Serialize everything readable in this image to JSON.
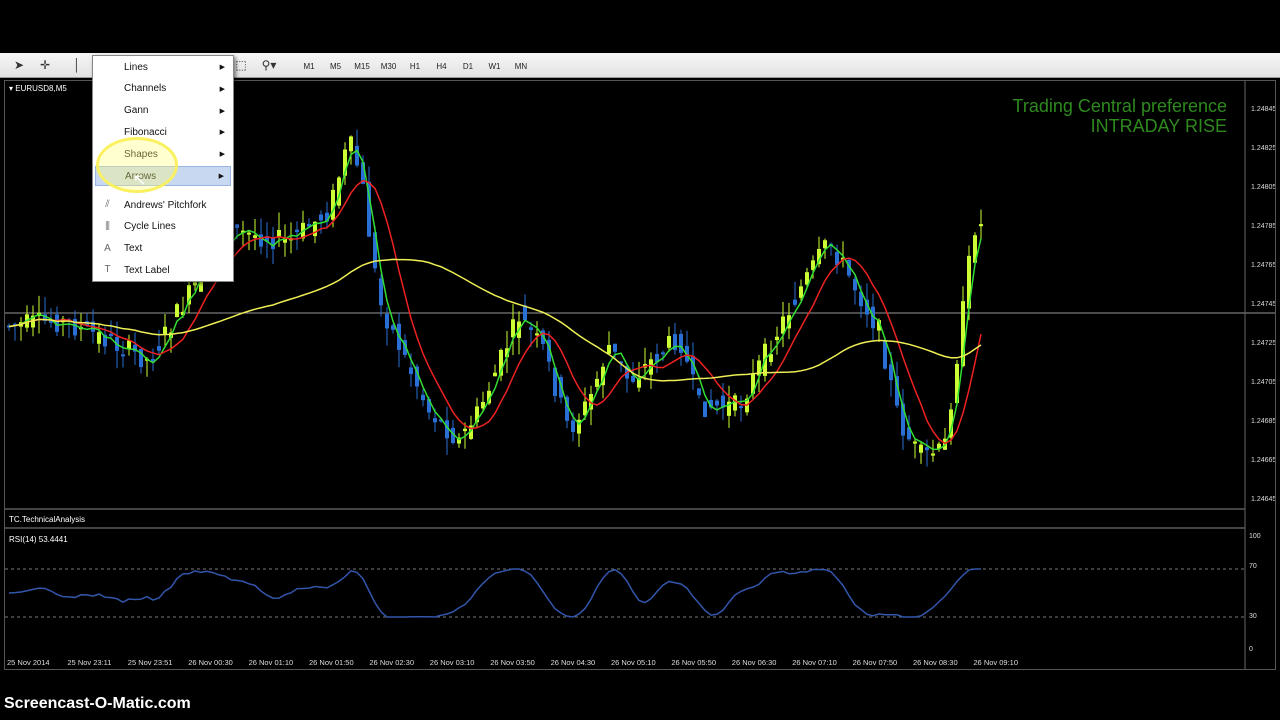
{
  "toolbar": {
    "timeframes": [
      "M1",
      "M5",
      "M15",
      "M30",
      "H1",
      "H4",
      "D1",
      "W1",
      "MN"
    ]
  },
  "chart": {
    "symbol_tab": "EURUSD8,M5",
    "info_line1": "Trading Central preference",
    "info_line2": "INTRADAY RISE",
    "price_labels": [
      "1.24845",
      "1.24825",
      "1.24805",
      "1.24785",
      "1.24765",
      "1.24745",
      "1.24725",
      "1.24705",
      "1.24685",
      "1.24665",
      "1.24645"
    ],
    "indicator_title": "TC.TechnicalAnalysis",
    "rsi_title": "RSI(14) 53.4441",
    "rsi_levels": [
      "100",
      "70",
      "30",
      "0"
    ],
    "time_labels": [
      "25 Nov 2014",
      "25 Nov 23:11",
      "25 Nov 23:51",
      "26 Nov 00:30",
      "26 Nov 01:10",
      "26 Nov 01:50",
      "26 Nov 02:30",
      "26 Nov 03:10",
      "26 Nov 03:50",
      "26 Nov 04:30",
      "26 Nov 05:10",
      "26 Nov 05:50",
      "26 Nov 06:30",
      "26 Nov 07:10",
      "26 Nov 07:50",
      "26 Nov 08:30",
      "26 Nov 09:10"
    ],
    "colors": {
      "bull": "#ccff33",
      "bear": "#2a6fd6",
      "ma_fast": "#33dd33",
      "ma_mid": "#ee2222",
      "ma_slow": "#eeee55",
      "rsi": "#3355aa",
      "info": "#2e8a1e"
    }
  },
  "context_menu": {
    "items": [
      {
        "label": "Lines",
        "icon": "",
        "submenu": true
      },
      {
        "label": "Channels",
        "icon": "",
        "submenu": true
      },
      {
        "label": "Gann",
        "icon": "",
        "submenu": true
      },
      {
        "label": "Fibonacci",
        "icon": "",
        "submenu": true
      },
      {
        "label": "Shapes",
        "icon": "",
        "submenu": true
      },
      {
        "label": "Arrows",
        "icon": "",
        "submenu": true
      },
      {
        "label": "Andrews' Pitchfork",
        "icon": "pitchfork-icon",
        "submenu": false
      },
      {
        "label": "Cycle Lines",
        "icon": "cycle-lines-icon",
        "submenu": false
      },
      {
        "label": "Text",
        "icon": "text-icon",
        "submenu": false
      },
      {
        "label": "Text Label",
        "icon": "text-label-icon",
        "submenu": false
      }
    ],
    "selected": "Arrows"
  },
  "watermark": "Screencast-O-Matic.com"
}
